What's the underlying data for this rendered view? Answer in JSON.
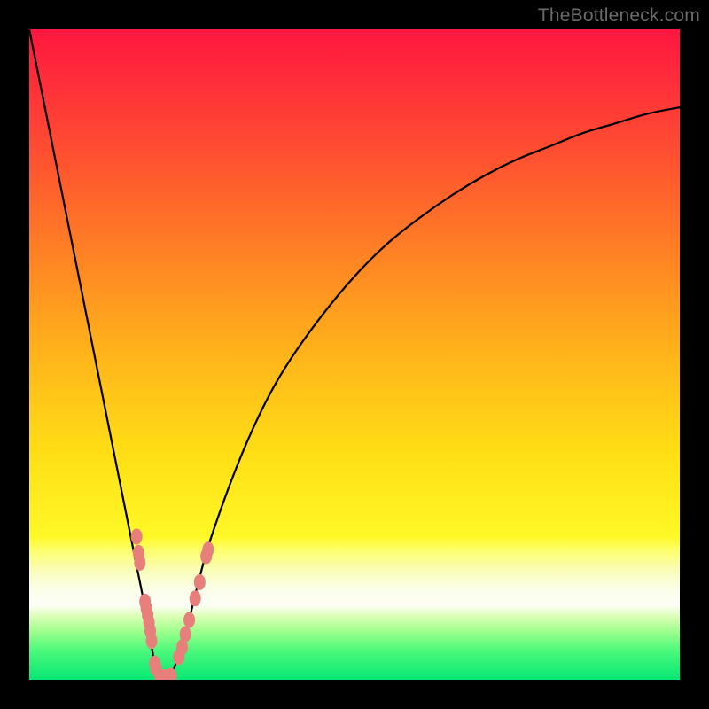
{
  "watermark": "TheBottleneck.com",
  "colors": {
    "frame": "#000000",
    "gradient_stops": [
      {
        "offset": 0.0,
        "color": "#ff163f"
      },
      {
        "offset": 0.08,
        "color": "#ff2e3a"
      },
      {
        "offset": 0.2,
        "color": "#ff5230"
      },
      {
        "offset": 0.35,
        "color": "#ff8324"
      },
      {
        "offset": 0.5,
        "color": "#ffb41a"
      },
      {
        "offset": 0.65,
        "color": "#ffde16"
      },
      {
        "offset": 0.78,
        "color": "#fff826"
      },
      {
        "offset": 0.8,
        "color": "#fdff6a"
      },
      {
        "offset": 0.83,
        "color": "#fafcb4"
      },
      {
        "offset": 0.86,
        "color": "#fbffe8"
      },
      {
        "offset": 0.885,
        "color": "#fefdf6"
      },
      {
        "offset": 0.905,
        "color": "#d6ffb0"
      },
      {
        "offset": 0.925,
        "color": "#9fff8d"
      },
      {
        "offset": 0.955,
        "color": "#4cf97b"
      },
      {
        "offset": 1.0,
        "color": "#06e872"
      }
    ],
    "curve": "#000000",
    "marker_fill": "#e77f7b",
    "marker_stroke": "#b34b47"
  },
  "chart_data": {
    "type": "line",
    "title": "",
    "xlabel": "",
    "ylabel": "",
    "xlim": [
      0,
      100
    ],
    "ylim": [
      0,
      100
    ],
    "note": "Axis numeric labels are not visible in the image; y is read as bottleneck % where 0 is at the bottom (green) and 100 at the top (red). Values are estimated from pixel positions against the gradient.",
    "series": [
      {
        "name": "bottleneck-curve-left",
        "x": [
          0.0,
          2.0,
          4.0,
          6.0,
          8.0,
          10.0,
          12.0,
          14.0,
          16.0,
          18.0,
          19.0,
          19.8
        ],
        "y": [
          100.0,
          90.0,
          80.0,
          70.0,
          60.0,
          50.0,
          40.0,
          30.0,
          20.0,
          10.0,
          4.0,
          0.7
        ]
      },
      {
        "name": "bottleneck-curve-right",
        "x": [
          22.0,
          24.0,
          26.0,
          28.0,
          32.0,
          36.0,
          40.0,
          45.0,
          50.0,
          55.0,
          60.0,
          65.0,
          70.0,
          75.0,
          80.0,
          85.0,
          90.0,
          95.0,
          100.0
        ],
        "y": [
          1.0,
          7.0,
          15.0,
          22.0,
          33.0,
          42.0,
          49.0,
          56.0,
          62.0,
          67.0,
          71.0,
          74.5,
          77.5,
          80.0,
          82.0,
          84.0,
          85.5,
          87.0,
          88.0
        ]
      }
    ],
    "markers": [
      {
        "series": "left-cluster",
        "x": 16.5,
        "y": 22.0
      },
      {
        "series": "left-cluster",
        "x": 16.8,
        "y": 19.5
      },
      {
        "series": "left-cluster",
        "x": 17.0,
        "y": 18.0
      },
      {
        "series": "left-cluster",
        "x": 17.8,
        "y": 12.0
      },
      {
        "series": "left-cluster",
        "x": 18.0,
        "y": 11.0
      },
      {
        "series": "left-cluster",
        "x": 18.2,
        "y": 10.0
      },
      {
        "series": "left-cluster",
        "x": 18.4,
        "y": 8.8
      },
      {
        "series": "left-cluster",
        "x": 18.6,
        "y": 7.5
      },
      {
        "series": "left-cluster",
        "x": 18.8,
        "y": 6.0
      },
      {
        "series": "left-cluster",
        "x": 19.3,
        "y": 2.5
      },
      {
        "series": "left-cluster",
        "x": 19.5,
        "y": 1.7
      },
      {
        "series": "bottom",
        "x": 20.1,
        "y": 0.5
      },
      {
        "series": "bottom",
        "x": 20.6,
        "y": 0.4
      },
      {
        "series": "bottom",
        "x": 21.2,
        "y": 0.4
      },
      {
        "series": "bottom",
        "x": 21.8,
        "y": 0.6
      },
      {
        "series": "right-cluster",
        "x": 23.0,
        "y": 3.5
      },
      {
        "series": "right-cluster",
        "x": 23.5,
        "y": 5.0
      },
      {
        "series": "right-cluster",
        "x": 24.0,
        "y": 7.0
      },
      {
        "series": "right-cluster",
        "x": 24.6,
        "y": 9.2
      },
      {
        "series": "right-cluster",
        "x": 25.5,
        "y": 12.5
      },
      {
        "series": "right-cluster",
        "x": 26.2,
        "y": 15.0
      },
      {
        "series": "right-cluster",
        "x": 27.2,
        "y": 19.0
      },
      {
        "series": "right-cluster",
        "x": 27.5,
        "y": 20.0
      }
    ]
  }
}
